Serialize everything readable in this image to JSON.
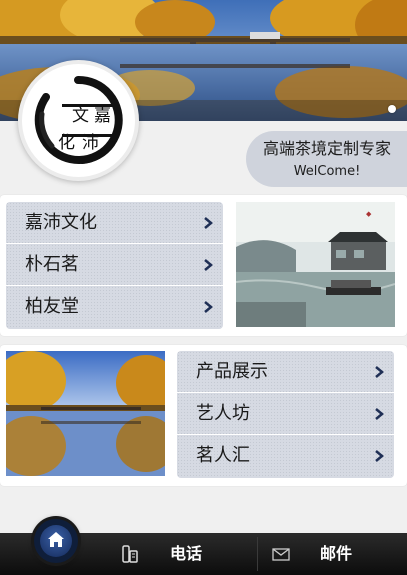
{
  "banner": {
    "slide_count": 1
  },
  "logo": {
    "chars": [
      "文",
      "嘉",
      "化",
      "沛"
    ]
  },
  "slogan": {
    "title": "高端茶境定制专家",
    "subtitle": "WelCome!"
  },
  "menu1": {
    "items": [
      {
        "label": "嘉沛文化"
      },
      {
        "label": "朴石茗"
      },
      {
        "label": "柏友堂"
      }
    ]
  },
  "menu2": {
    "items": [
      {
        "label": "产品展示"
      },
      {
        "label": "艺人坊"
      },
      {
        "label": "茗人汇"
      }
    ]
  },
  "bottombar": {
    "home_icon": "home-icon",
    "phone_label": "电话",
    "mail_label": "邮件"
  },
  "colors": {
    "menu_bg": "#d6dae3",
    "bar_bg": "#111111",
    "home_btn": "#142a5a"
  }
}
